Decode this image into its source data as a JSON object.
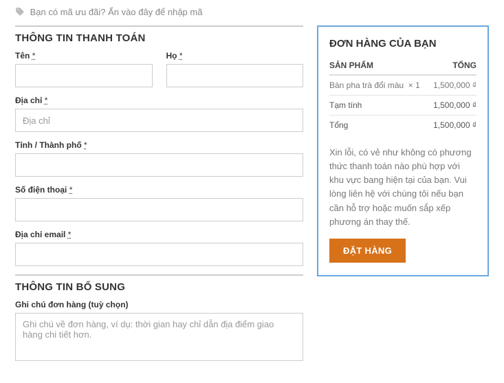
{
  "coupon": {
    "prompt": "Bạn có mã ưu đãi?",
    "link": "Ấn vào đây để nhập mã"
  },
  "billing": {
    "title": "THÔNG TIN THANH TOÁN",
    "first_name_label": "Tên",
    "last_name_label": "Họ",
    "address_label": "Địa chỉ",
    "address_placeholder": "Địa chỉ",
    "city_label": "Tỉnh / Thành phố",
    "phone_label": "Số điện thoại",
    "email_label": "Địa chỉ email",
    "required_mark": "*"
  },
  "additional": {
    "title": "THÔNG TIN BỔ SUNG",
    "notes_label": "Ghi chú đơn hàng (tuỳ chọn)",
    "notes_placeholder": "Ghi chú về đơn hàng, ví dụ: thời gian hay chỉ dẫn địa điểm giao hàng chi tiết hơn."
  },
  "order": {
    "title": "ĐƠN HÀNG CỦA BẠN",
    "col_product": "SẢN PHẨM",
    "col_total": "TỔNG",
    "item_name": "Bàn pha trà đổi màu",
    "item_qty": "× 1",
    "item_price": "1,500,000 ₫",
    "subtotal_label": "Tạm tính",
    "subtotal_value": "1,500,000 ₫",
    "total_label": "Tổng",
    "total_value": "1,500,000 ₫",
    "payment_notice": "Xin lỗi, có vẻ như không có phương thức thanh toán nào phù hợp với khu vực bang hiện tại của bạn. Vui lòng liên hệ với chúng tôi nếu bạn cần hỗ trợ hoặc muốn sắp xếp phương án thay thế.",
    "button": "ĐẶT HÀNG"
  }
}
